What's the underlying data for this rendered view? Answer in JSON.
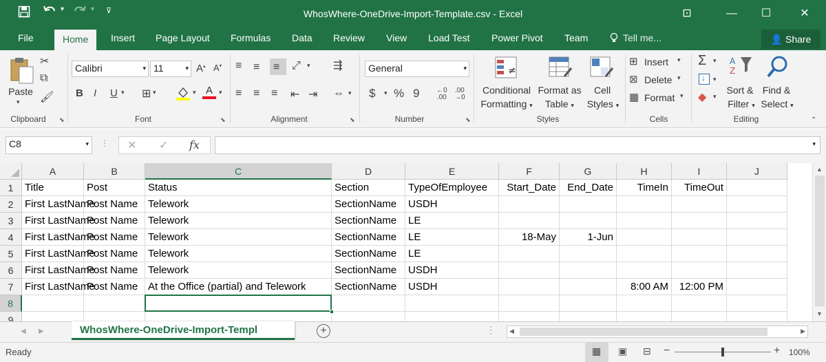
{
  "window": {
    "title": "WhosWhere-OneDrive-Import-Template.csv - Excel",
    "controls": {
      "ribbon_display": "⊡",
      "minimize": "—",
      "maximize": "☐",
      "close": "✕"
    }
  },
  "quick_access": {
    "save_icon": "save-icon",
    "undo_icon": "undo-icon",
    "redo_icon": "redo-icon",
    "customize_icon": "chevron-down-icon"
  },
  "tabs": [
    "File",
    "Home",
    "Insert",
    "Page Layout",
    "Formulas",
    "Data",
    "Review",
    "View",
    "Load Test",
    "Power Pivot",
    "Team"
  ],
  "tell_me": "Tell me...",
  "share_label": "Share",
  "ribbon": {
    "clipboard": {
      "paste": "Paste",
      "label": "Clipboard"
    },
    "font": {
      "name": "Calibri",
      "size": "11",
      "bold": "B",
      "italic": "I",
      "underline": "U",
      "label": "Font"
    },
    "alignment": {
      "label": "Alignment"
    },
    "number": {
      "format": "General",
      "currency": "$",
      "percent": "%",
      "comma": "9",
      "label": "Number"
    },
    "styles": {
      "conditional": [
        "Conditional",
        "Formatting"
      ],
      "format_as": [
        "Format as",
        "Table"
      ],
      "cell_styles": [
        "Cell",
        "Styles"
      ],
      "label": "Styles"
    },
    "cells": {
      "insert": "Insert",
      "delete": "Delete",
      "format": "Format",
      "label": "Cells"
    },
    "editing": {
      "sort": [
        "Sort &",
        "Filter"
      ],
      "find": [
        "Find &",
        "Select"
      ],
      "label": "Editing"
    }
  },
  "name_box": "C8",
  "formula_value": "",
  "fx_label": "fx",
  "columns": [
    "A",
    "B",
    "C",
    "D",
    "E",
    "F",
    "G",
    "H",
    "I",
    "J"
  ],
  "selected_column": "C",
  "rows": [
    [
      "Title",
      "Post",
      "Status",
      "Section",
      "TypeOfEmployee",
      "Start_Date",
      "End_Date",
      "TimeIn",
      "TimeOut",
      ""
    ],
    [
      "First LastName",
      "Post Name",
      "Telework",
      "SectionName",
      "USDH",
      "",
      "",
      "",
      "",
      ""
    ],
    [
      "First LastName",
      "Post Name",
      "Telework",
      "SectionName",
      "LE",
      "",
      "",
      "",
      "",
      ""
    ],
    [
      "First LastName",
      "Post Name",
      "Telework",
      "SectionName",
      "LE",
      "18-May",
      "1-Jun",
      "",
      "",
      ""
    ],
    [
      "First LastName",
      "Post Name",
      "Telework",
      "SectionName",
      "LE",
      "",
      "",
      "",
      "",
      ""
    ],
    [
      "First LastName",
      "Post Name",
      "Telework",
      "SectionName",
      "USDH",
      "",
      "",
      "",
      "",
      ""
    ],
    [
      "First LastName",
      "Post Name",
      "At the Office (partial) and Telework",
      "SectionName",
      "USDH",
      "",
      "",
      "8:00 AM",
      "12:00 PM",
      ""
    ],
    [
      "",
      "",
      "",
      "",
      "",
      "",
      "",
      "",
      "",
      ""
    ],
    [
      "",
      "",
      "",
      "",
      "",
      "",
      "",
      "",
      "",
      ""
    ]
  ],
  "row_numbers": [
    "1",
    "2",
    "3",
    "4",
    "5",
    "6",
    "7",
    "8",
    "9"
  ],
  "selected_row": "8",
  "sheet_tab": "WhosWhere-OneDrive-Import-Templ",
  "status_text": "Ready",
  "zoom": "100%",
  "accent": "#217346"
}
